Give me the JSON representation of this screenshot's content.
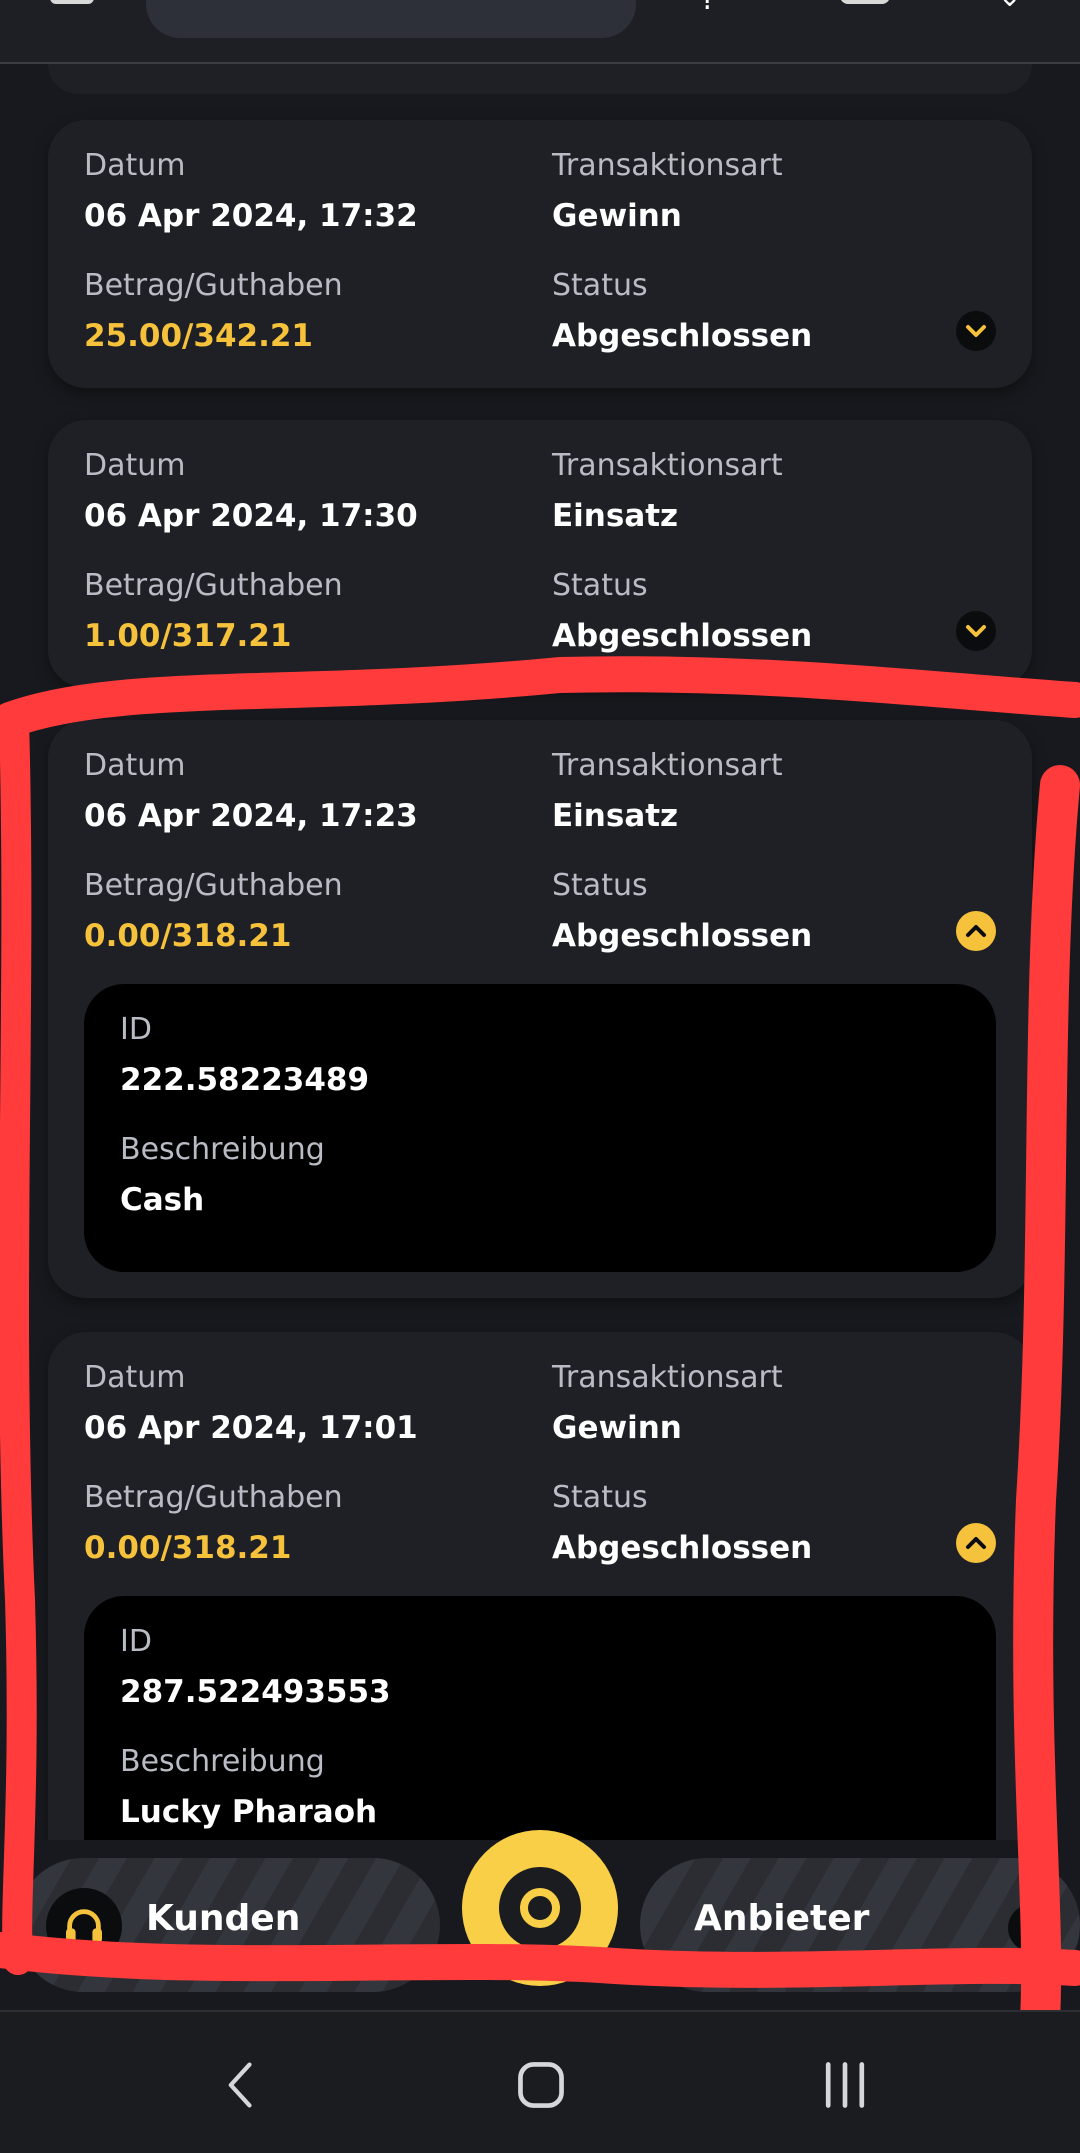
{
  "colors": {
    "background": "#17191e",
    "card": "#1e2026",
    "accent": "#f6c23c",
    "annotation": "#ff3b3b"
  },
  "labels": {
    "date": "Datum",
    "type": "Transaktionsart",
    "amount": "Betrag/Guthaben",
    "status": "Status",
    "id": "ID",
    "description": "Beschreibung"
  },
  "transactions": [
    {
      "date": "06 Apr 2024, 17:32",
      "type": "Gewinn",
      "amount": "25.00/342.21",
      "status": "Abgeschlossen",
      "expanded": false
    },
    {
      "date": "06 Apr 2024, 17:30",
      "type": "Einsatz",
      "amount": "1.00/317.21",
      "status": "Abgeschlossen",
      "expanded": false
    },
    {
      "date": "06 Apr 2024, 17:23",
      "type": "Einsatz",
      "amount": "0.00/318.21",
      "status": "Abgeschlossen",
      "expanded": true,
      "id": "222.58223489",
      "description": "Cash"
    },
    {
      "date": "06 Apr 2024, 17:01",
      "type": "Gewinn",
      "amount": "0.00/318.21",
      "status": "Abgeschlossen",
      "expanded": true,
      "id": "287.522493553",
      "description": "Lucky Pharaoh"
    }
  ],
  "bottom_bar": {
    "support_label": "Kunden",
    "provider_label": "Anbieter"
  },
  "system_nav": {
    "icons": [
      "back-icon",
      "home-icon",
      "recents-icon"
    ]
  }
}
